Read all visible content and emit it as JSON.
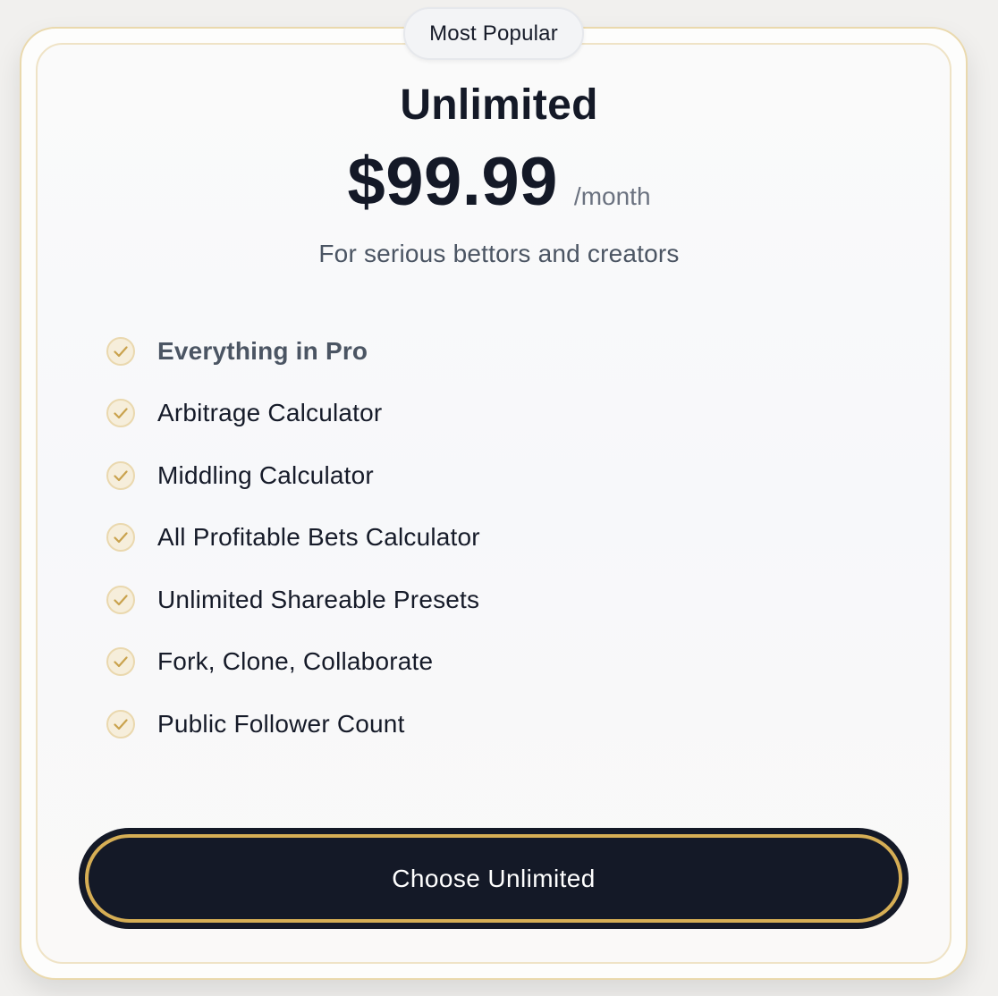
{
  "badge": {
    "label": "Most Popular"
  },
  "plan": {
    "name": "Unlimited",
    "price": "$99.99",
    "period": "/month",
    "tagline": "For serious bettors and creators"
  },
  "features": [
    {
      "label": "Everything in Pro",
      "icon": "check-circle-icon"
    },
    {
      "label": "Arbitrage Calculator",
      "icon": "check-circle-icon"
    },
    {
      "label": "Middling Calculator",
      "icon": "check-circle-icon"
    },
    {
      "label": "All Profitable Bets Calculator",
      "icon": "check-circle-icon"
    },
    {
      "label": "Unlimited Shareable Presets",
      "icon": "check-circle-icon"
    },
    {
      "label": "Fork, Clone, Collaborate",
      "icon": "check-circle-icon"
    },
    {
      "label": "Public Follower Count",
      "icon": "check-circle-icon"
    }
  ],
  "cta": {
    "label": "Choose Unlimited"
  },
  "colors": {
    "accent_gold": "#d6ae55",
    "check_fill": "#f6eedb",
    "check_stroke": "#c9a24d",
    "dark": "#141927",
    "border_gold": "#ead9ad"
  }
}
